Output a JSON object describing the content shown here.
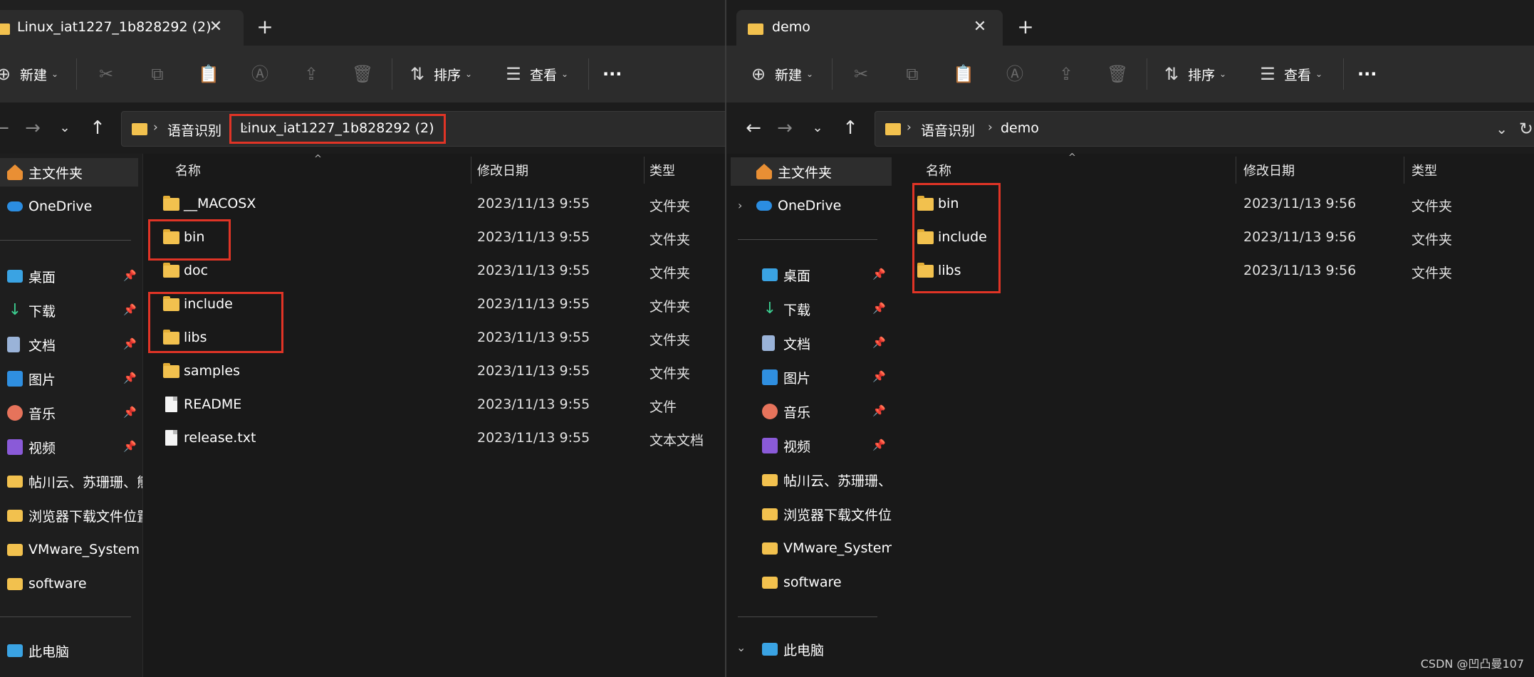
{
  "left_window": {
    "tab_title": "Linux_iat1227_1b828292 (2)",
    "toolbar": {
      "new_label": "新建",
      "sort_label": "排序",
      "view_label": "查看",
      "more_label": "···"
    },
    "breadcrumb": [
      "语音识别",
      "Linux_iat1227_1b828292 (2)"
    ],
    "sidebar": [
      {
        "label": "主文件夹",
        "icon": "home-icon"
      },
      {
        "label": "OneDrive",
        "icon": "onedrive-icon"
      },
      {
        "label": "桌面",
        "icon": "desktop-icon",
        "pinned": true
      },
      {
        "label": "下载",
        "icon": "download-icon",
        "pinned": true
      },
      {
        "label": "文档",
        "icon": "documents-icon",
        "pinned": true
      },
      {
        "label": "图片",
        "icon": "pictures-icon",
        "pinned": true
      },
      {
        "label": "音乐",
        "icon": "music-icon",
        "pinned": true
      },
      {
        "label": "视频",
        "icon": "videos-icon",
        "pinned": true
      },
      {
        "label": "帖川云、苏珊珊、熊",
        "icon": "folder-icon"
      },
      {
        "label": "浏览器下载文件位置",
        "icon": "folder-icon"
      },
      {
        "label": "VMware_System",
        "icon": "folder-icon"
      },
      {
        "label": "software",
        "icon": "folder-icon"
      },
      {
        "label": "此电脑",
        "icon": "this-pc-icon"
      }
    ],
    "columns": {
      "name": "名称",
      "date": "修改日期",
      "type": "类型"
    },
    "files": [
      {
        "name": "__MACOSX",
        "date": "2023/11/13 9:55",
        "type": "文件夹",
        "kind": "folder"
      },
      {
        "name": "bin",
        "date": "2023/11/13 9:55",
        "type": "文件夹",
        "kind": "folder"
      },
      {
        "name": "doc",
        "date": "2023/11/13 9:55",
        "type": "文件夹",
        "kind": "folder"
      },
      {
        "name": "include",
        "date": "2023/11/13 9:55",
        "type": "文件夹",
        "kind": "folder"
      },
      {
        "name": "libs",
        "date": "2023/11/13 9:55",
        "type": "文件夹",
        "kind": "folder"
      },
      {
        "name": "samples",
        "date": "2023/11/13 9:55",
        "type": "文件夹",
        "kind": "folder"
      },
      {
        "name": "README",
        "date": "2023/11/13 9:55",
        "type": "文件",
        "kind": "file"
      },
      {
        "name": "release.txt",
        "date": "2023/11/13 9:55",
        "type": "文本文档",
        "kind": "file"
      }
    ]
  },
  "right_window": {
    "tab_title": "demo",
    "toolbar": {
      "new_label": "新建",
      "sort_label": "排序",
      "view_label": "查看",
      "more_label": "···"
    },
    "breadcrumb": [
      "语音识别",
      "demo"
    ],
    "sidebar": [
      {
        "label": "主文件夹",
        "icon": "home-icon"
      },
      {
        "label": "OneDrive",
        "icon": "onedrive-icon"
      },
      {
        "label": "桌面",
        "icon": "desktop-icon",
        "pinned": true
      },
      {
        "label": "下载",
        "icon": "download-icon",
        "pinned": true
      },
      {
        "label": "文档",
        "icon": "documents-icon",
        "pinned": true
      },
      {
        "label": "图片",
        "icon": "pictures-icon",
        "pinned": true
      },
      {
        "label": "音乐",
        "icon": "music-icon",
        "pinned": true
      },
      {
        "label": "视频",
        "icon": "videos-icon",
        "pinned": true
      },
      {
        "label": "帖川云、苏珊珊、熊",
        "icon": "folder-icon"
      },
      {
        "label": "浏览器下载文件位置",
        "icon": "folder-icon"
      },
      {
        "label": "VMware_System",
        "icon": "folder-icon"
      },
      {
        "label": "software",
        "icon": "folder-icon"
      },
      {
        "label": "此电脑",
        "icon": "this-pc-icon"
      }
    ],
    "columns": {
      "name": "名称",
      "date": "修改日期",
      "type": "类型"
    },
    "files": [
      {
        "name": "bin",
        "date": "2023/11/13 9:56",
        "type": "文件夹",
        "kind": "folder"
      },
      {
        "name": "include",
        "date": "2023/11/13 9:56",
        "type": "文件夹",
        "kind": "folder"
      },
      {
        "name": "libs",
        "date": "2023/11/13 9:56",
        "type": "文件夹",
        "kind": "folder"
      }
    ]
  },
  "watermark": "CSDN @凹凸曼107",
  "colors": {
    "highlight_box": "#e03426",
    "folder": "#f2c14e",
    "background": "#191919"
  }
}
